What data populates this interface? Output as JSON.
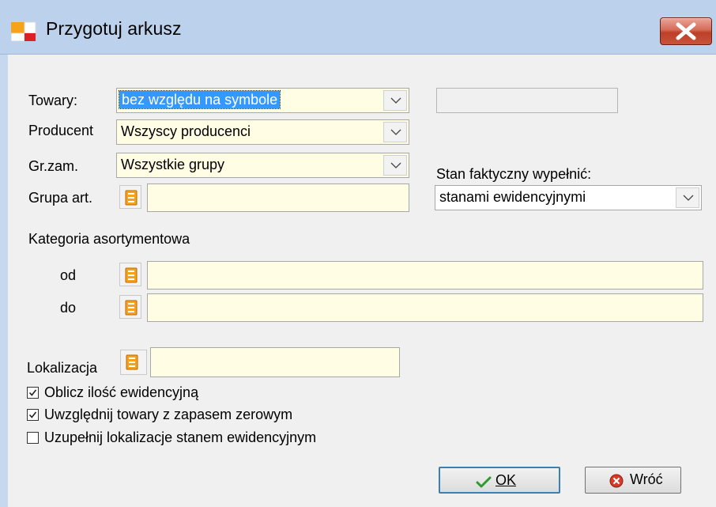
{
  "window": {
    "title": "Przygotuj arkusz"
  },
  "form": {
    "towary_label": "Towary:",
    "towary_value": "bez względu na symbole",
    "producent_label": "Producent",
    "producent_value": "Wszyscy producenci",
    "grzam_label": "Gr.zam.",
    "grzam_value": "Wszystkie grupy",
    "grupa_label": "Grupa art.",
    "grupa_value": "",
    "stan_label": "Stan faktyczny wypełnić:",
    "stan_value": "stanami ewidencyjnymi",
    "kategoria_label": "Kategoria asortymentowa",
    "od_label": "od",
    "od_value": "",
    "do_label": "do",
    "do_value": "",
    "lokalizacja_label": "Lokalizacja",
    "lokalizacja_value": ""
  },
  "checkboxes": [
    {
      "label": "Oblicz ilość ewidencyjną",
      "checked": true
    },
    {
      "label": "Uwzględnij towary z zapasem zerowym",
      "checked": true
    },
    {
      "label": "Uzupełnij lokalizacje stanem ewidencyjnym",
      "checked": false
    }
  ],
  "buttons": {
    "ok_label": "OK",
    "back_label": "Wróć"
  },
  "colors": {
    "field_bg": "#fffde3",
    "selection": "#3399ff",
    "titlebar": "#bcd2ec"
  },
  "icons": {
    "picker": "list-picker-icon",
    "ok": "checkmark-icon",
    "back": "cancel-icon",
    "close": "close-icon"
  }
}
